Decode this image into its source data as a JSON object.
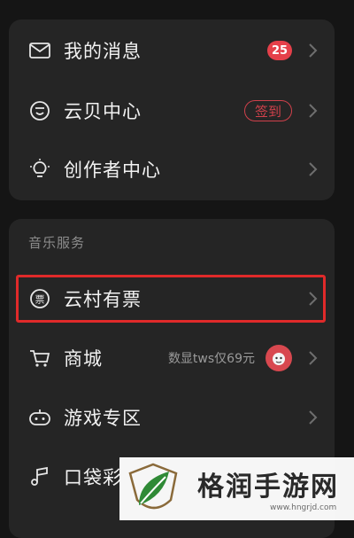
{
  "card_one": {
    "items": [
      {
        "label": "我的消息",
        "icon": "mail-icon",
        "badge": "25"
      },
      {
        "label": "云贝中心",
        "icon": "cloud-coin-icon",
        "action": "签到"
      },
      {
        "label": "创作者中心",
        "icon": "lightbulb-icon"
      }
    ]
  },
  "music_services": {
    "title": "音乐服务",
    "items": [
      {
        "label": "云村有票",
        "icon": "ticket-icon",
        "highlighted": true
      },
      {
        "label": "商城",
        "icon": "cart-icon",
        "promo": "数显tws仅69元"
      },
      {
        "label": "游戏专区",
        "icon": "gamepad-icon"
      },
      {
        "label": "口袋彩",
        "icon": "music-note-icon"
      }
    ]
  },
  "watermark": {
    "text": "格润手游网",
    "url": "www.hngrjd.com"
  },
  "colors": {
    "background": "#151515",
    "card": "#252525",
    "accent": "#e5404a",
    "highlight_border": "#e02a2a"
  }
}
